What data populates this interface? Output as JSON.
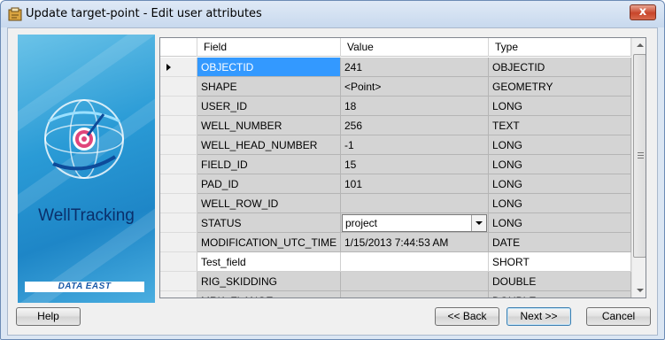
{
  "window": {
    "title": "Update target-point - Edit user attributes",
    "close_label": "x"
  },
  "banner": {
    "product_name": "WellTracking",
    "company_logo": "DATA EAST"
  },
  "grid": {
    "columns": [
      "Field",
      "Value",
      "Type"
    ],
    "rows": [
      {
        "field": "OBJECTID",
        "value": "241",
        "type": "OBJECTID"
      },
      {
        "field": "SHAPE",
        "value": "<Point>",
        "type": "GEOMETRY"
      },
      {
        "field": "USER_ID",
        "value": "18",
        "type": "LONG"
      },
      {
        "field": "WELL_NUMBER",
        "value": "256",
        "type": "TEXT"
      },
      {
        "field": "WELL_HEAD_NUMBER",
        "value": "-1",
        "type": "LONG"
      },
      {
        "field": "FIELD_ID",
        "value": "15",
        "type": "LONG"
      },
      {
        "field": "PAD_ID",
        "value": "101",
        "type": "LONG"
      },
      {
        "field": "WELL_ROW_ID",
        "value": "",
        "type": "LONG"
      },
      {
        "field": "STATUS",
        "value": "project",
        "type": "LONG"
      },
      {
        "field": "MODIFICATION_UTC_TIME",
        "value": "1/15/2013 7:44:53 AM",
        "type": "DATE"
      },
      {
        "field": "Test_field",
        "value": "",
        "type": "SHORT"
      },
      {
        "field": "RIG_SKIDDING",
        "value": "",
        "type": "DOUBLE"
      },
      {
        "field": "MRK_FLANGE",
        "value": "",
        "type": "DOUBLE"
      }
    ]
  },
  "buttons": {
    "help": "Help",
    "back": "<< Back",
    "next": "Next >>",
    "cancel": "Cancel"
  },
  "icons": {
    "title": "app-icon",
    "close": "close-icon",
    "current_row": "current-row-arrow-icon",
    "dropdown": "chevron-down-icon"
  }
}
